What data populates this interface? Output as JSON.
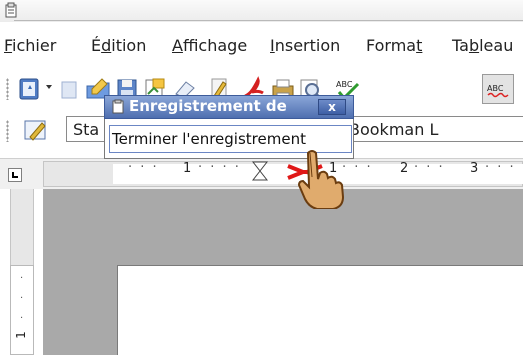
{
  "menubar": {
    "items": [
      {
        "label": "Fichier",
        "underline": "F",
        "rest": "ichier"
      },
      {
        "label": "Édition",
        "pre": "É",
        "underline": "d",
        "rest": "ition"
      },
      {
        "label": "Affichage",
        "underline": "A",
        "rest": "ffichage"
      },
      {
        "label": "Insertion",
        "underline": "I",
        "rest": "nsertion"
      },
      {
        "label": "Format",
        "pre": "Forma",
        "underline": "t",
        "rest": ""
      },
      {
        "label": "Tableau",
        "pre": "Ta",
        "underline": "b",
        "rest": "leau"
      }
    ]
  },
  "toolbar2": {
    "style_combo": "Sta",
    "font_combo": "Bookman L"
  },
  "ruler": {
    "numbers": [
      "1",
      "1",
      "2",
      "3"
    ],
    "vertical_number": "1"
  },
  "recording_window": {
    "title": "Enregistrement de",
    "close_label": "x",
    "button_label": "Terminer l'enregistrement"
  },
  "icons": [
    "app-icon",
    "new-document-icon",
    "open-folder-icon",
    "save-icon",
    "edit-file-icon",
    "email-icon",
    "edit-mode-icon",
    "pdf-export-icon",
    "print-icon",
    "print-preview-icon",
    "spellcheck-icon",
    "autospellcheck-icon",
    "styles-icon",
    "hand-pointer-icon"
  ]
}
